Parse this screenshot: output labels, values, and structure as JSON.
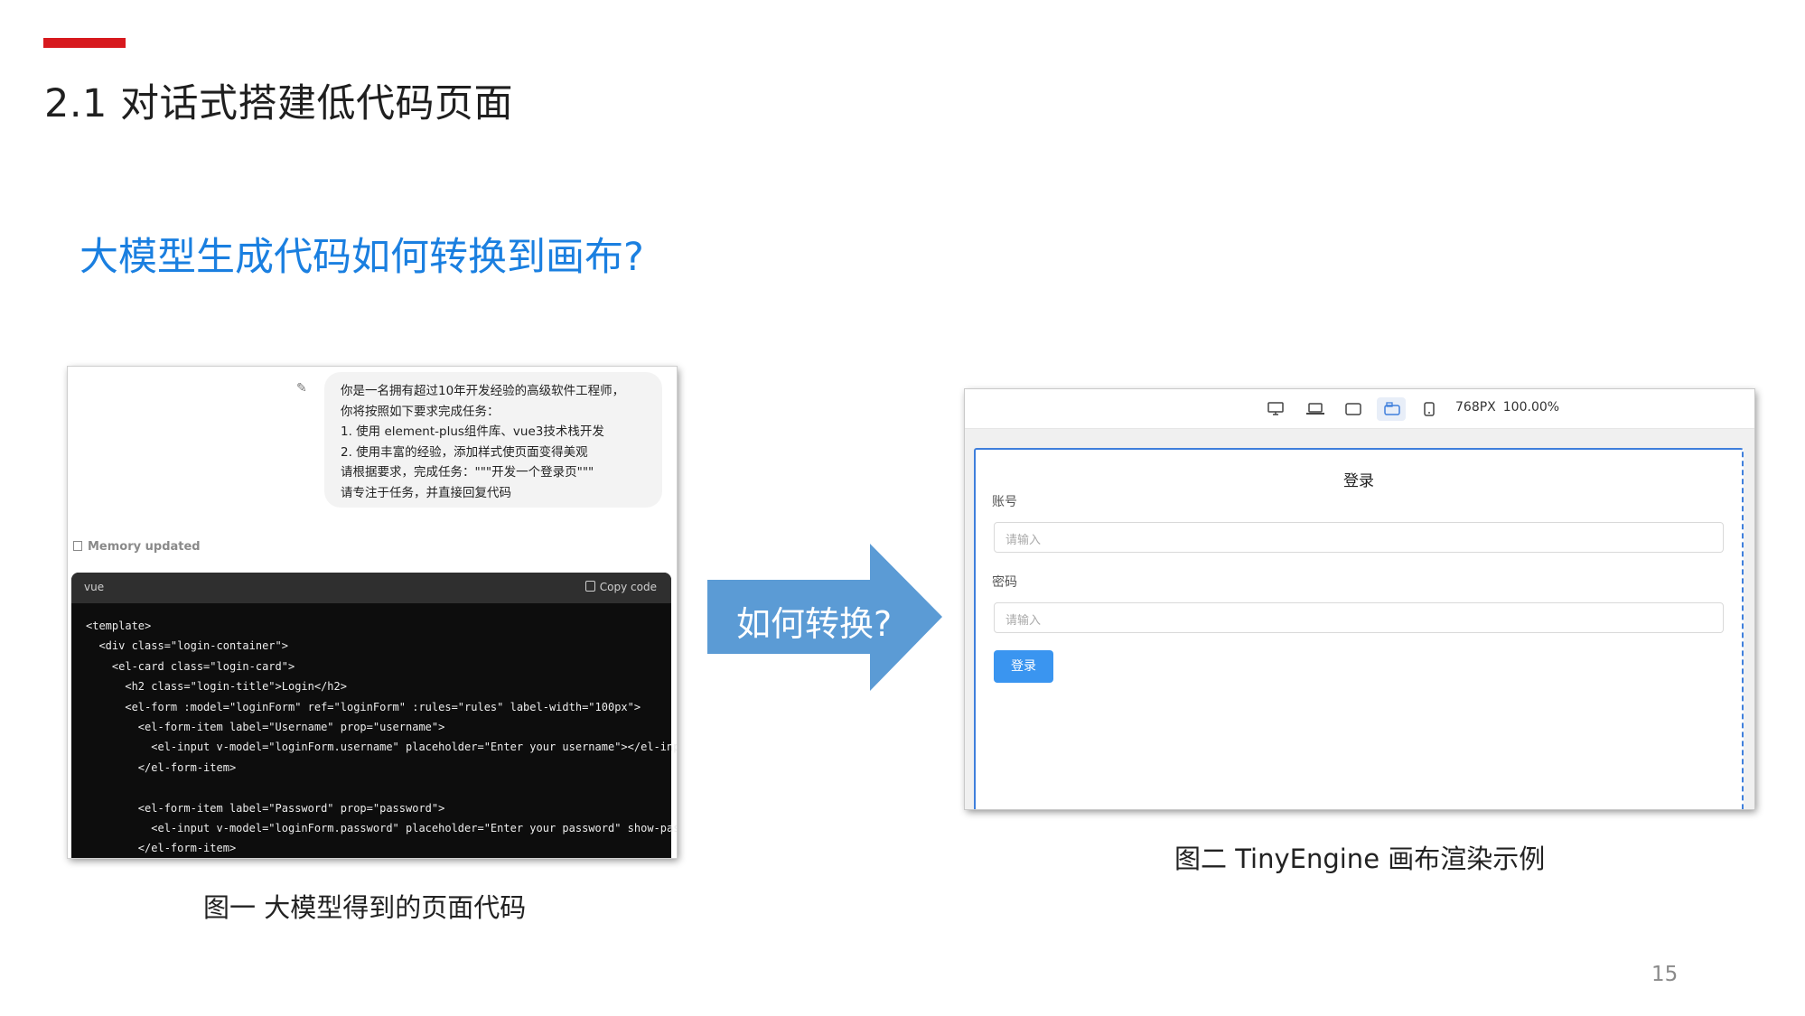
{
  "slide": {
    "title": "2.1 对话式搭建低代码页面",
    "subtitle": "大模型生成代码如何转换到画布?",
    "page_number": "15",
    "accent_color": "#d7191e",
    "subtitle_color": "#1a7fe0"
  },
  "figure1": {
    "prompt_lines": [
      "你是一名拥有超过10年开发经验的高级软件工程师，",
      "你将按照如下要求完成任务：",
      "1. 使用 element-plus组件库、vue3技术栈开发",
      "2. 使用丰富的经验，添加样式使页面变得美观",
      "请根据要求，完成任务：\"\"\"开发一个登录页\"\"\"",
      "请专注于任务，并直接回复代码"
    ],
    "memory_text": "Memory updated",
    "code_lang": "vue",
    "copy_label": "Copy code",
    "code_lines": [
      "<template>",
      "  <div class=\"login-container\">",
      "    <el-card class=\"login-card\">",
      "      <h2 class=\"login-title\">Login</h2>",
      "      <el-form :model=\"loginForm\" ref=\"loginForm\" :rules=\"rules\" label-width=\"100px\">",
      "        <el-form-item label=\"Username\" prop=\"username\">",
      "          <el-input v-model=\"loginForm.username\" placeholder=\"Enter your username\"></el-input>",
      "        </el-form-item>",
      "",
      "        <el-form-item label=\"Password\" prop=\"password\">",
      "          <el-input v-model=\"loginForm.password\" placeholder=\"Enter your password\" show-password></el-input>",
      "        </el-form-item>"
    ],
    "caption": "图一  大模型得到的页面代码"
  },
  "arrow": {
    "label": "如何转换?",
    "color": "#5b9bd5"
  },
  "figure2": {
    "toolbar_icons": [
      "desktop-icon",
      "laptop-icon",
      "tablet-icon",
      "tablet-landscape-icon",
      "phone-icon"
    ],
    "viewport_width": "768PX",
    "zoom": "100.00%",
    "login_title": "登录",
    "account_label": "账号",
    "account_placeholder": "请输入",
    "password_label": "密码",
    "password_placeholder": "请输入",
    "login_button": "登录",
    "button_color": "#3a95f0",
    "caption": "图二  TinyEngine 画布渲染示例"
  }
}
